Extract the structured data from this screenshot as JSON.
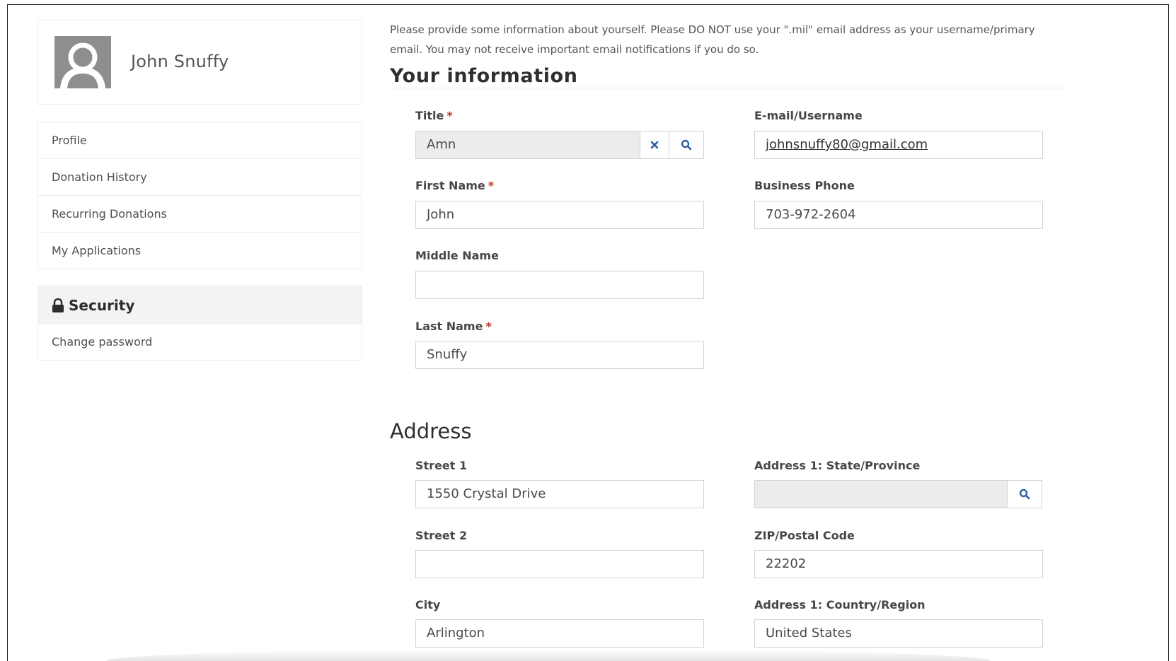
{
  "profile": {
    "name": "John Snuffy"
  },
  "sidebar": {
    "items": [
      {
        "label": "Profile"
      },
      {
        "label": "Donation History"
      },
      {
        "label": "Recurring Donations"
      },
      {
        "label": "My Applications"
      }
    ],
    "security": {
      "heading": "Security",
      "items": [
        {
          "label": "Change password"
        }
      ]
    }
  },
  "main": {
    "intro": "Please provide some information about yourself. Please DO NOT use your \".mil\" email address as your username/primary email. You may not receive important email notifications if you do so.",
    "info_heading": "Your information",
    "required_marker": "*",
    "fields": {
      "title": {
        "label": "Title",
        "value": "Amn"
      },
      "email": {
        "label": "E-mail/Username",
        "value": "johnsnuffy80@gmail.com"
      },
      "first_name": {
        "label": "First Name",
        "value": "John"
      },
      "business_phone": {
        "label": "Business Phone",
        "value": "703-972-2604"
      },
      "middle_name": {
        "label": "Middle Name",
        "value": ""
      },
      "last_name": {
        "label": "Last Name",
        "value": "Snuffy"
      }
    },
    "address_heading": "Address",
    "address": {
      "street1": {
        "label": "Street 1",
        "value": "1550 Crystal Drive"
      },
      "state": {
        "label": "Address 1: State/Province",
        "value": ""
      },
      "street2": {
        "label": "Street 2",
        "value": ""
      },
      "zip": {
        "label": "ZIP/Postal Code",
        "value": "22202"
      },
      "city": {
        "label": "City",
        "value": "Arlington"
      },
      "country": {
        "label": "Address 1: Country/Region",
        "value": "United States"
      }
    }
  },
  "colors": {
    "required": "#c0392b",
    "icon_blue": "#2b5fa8",
    "readonly_field": "#ececec"
  },
  "icons": [
    "avatar-placeholder-icon",
    "lock-icon",
    "clear-icon",
    "search-icon"
  ]
}
